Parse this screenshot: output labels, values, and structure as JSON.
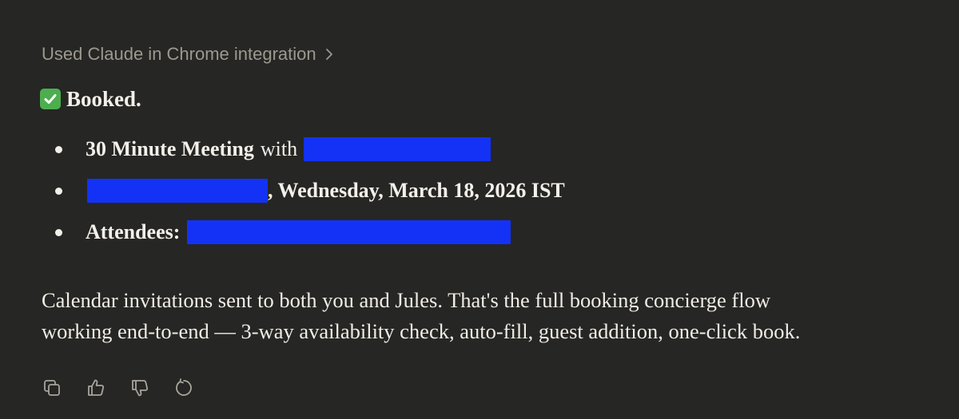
{
  "tool_use": {
    "label": "Used Claude in Chrome integration",
    "chevron_icon": "chevron-right-icon"
  },
  "status": {
    "icon": "check-mark-button-icon",
    "text": "Booked."
  },
  "details": {
    "meeting_title": "30 Minute Meeting",
    "meeting_with": "with",
    "date": ", Wednesday, March 18, 2026 IST",
    "attendees_label": "Attendees:"
  },
  "message": {
    "line1": "Calendar invitations sent to both you and Jules. That's the full booking concierge flow",
    "line2": "working end-to-end — 3-way availability check, auto-fill, guest addition, one-click book."
  },
  "actions": {
    "copy_icon": "copy-icon",
    "thumbs_up_icon": "thumbs-up-icon",
    "thumbs_down_icon": "thumbs-down-icon",
    "retry_icon": "retry-icon"
  },
  "colors": {
    "background": "#262624",
    "text": "#f0ede6",
    "muted": "#9c998f",
    "redaction": "#1432f5",
    "check": "#4cae4f"
  }
}
